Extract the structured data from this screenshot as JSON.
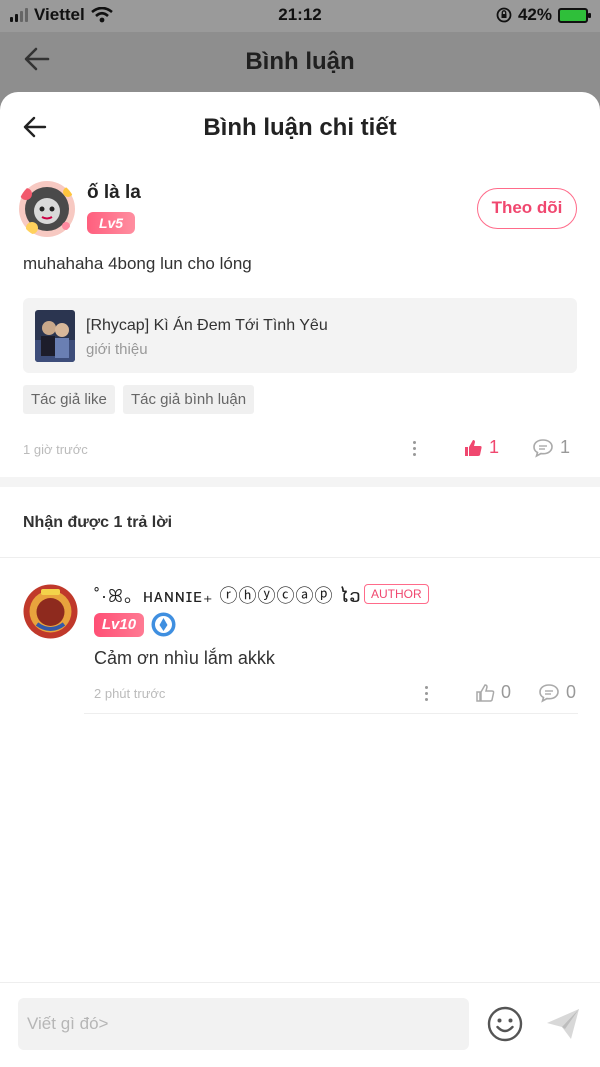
{
  "status": {
    "carrier": "Viettel",
    "time": "21:12",
    "battery": "42%"
  },
  "background_header": {
    "title": "Bình luận"
  },
  "sheet": {
    "title": "Bình luận chi tiết"
  },
  "comment": {
    "username": "ố là la",
    "level": "Lv5",
    "follow_label": "Theo dõi",
    "text": "muhahaha 4bong lun cho lóng",
    "story": {
      "title": "[Rhycap] Kì Án Đem Tới Tình Yêu",
      "subtitle": "giới thiệu"
    },
    "tags": [
      "Tác giả like",
      "Tác giả bình luận"
    ],
    "time": "1 giờ trước",
    "likes": "1",
    "replies": "1"
  },
  "replies_header": "Nhận được 1 trả lời",
  "reply": {
    "username": "˚·ꕤ。ʜᴀɴɴɪᴇ₊ ⓡⓗⓨⓒⓐⓟ ໄວ",
    "author_badge": "AUTHOR",
    "level": "Lv10",
    "text": "Cảm ơn nhìu lắm akkk",
    "time": "2 phút trước",
    "likes": "0",
    "replies": "0"
  },
  "composer": {
    "placeholder": "Viết gì đó>"
  },
  "colors": {
    "accent": "#f0476f",
    "level_badge": "#ff5f7e",
    "overlay": "#8e8e8e"
  }
}
